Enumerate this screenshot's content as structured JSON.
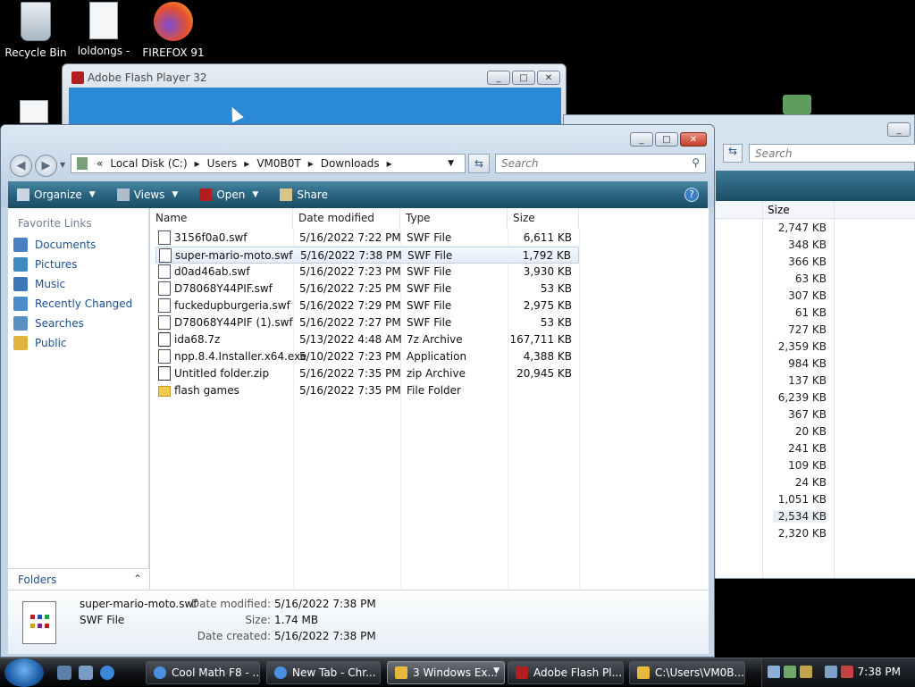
{
  "desktop": {
    "icons": [
      {
        "label": "Recycle Bin"
      },
      {
        "label": "loldongs -"
      },
      {
        "label": "FIREFOX 91"
      }
    ]
  },
  "flash_window": {
    "title": "Adobe Flash Player 32"
  },
  "bg_window": {
    "search_placeholder": "Search",
    "size_header": "Size",
    "sizes": [
      "2,747 KB",
      "348 KB",
      "366 KB",
      "63 KB",
      "307 KB",
      "61 KB",
      "727 KB",
      "2,359 KB",
      "984 KB",
      "137 KB",
      "6,239 KB",
      "367 KB",
      "20 KB",
      "241 KB",
      "109 KB",
      "24 KB",
      "1,051 KB",
      "2,534 KB",
      "2,320 KB"
    ]
  },
  "explorer": {
    "address": {
      "root": "«",
      "parts": [
        "Local Disk (C:)",
        "Users",
        "VM0B0T",
        "Downloads"
      ]
    },
    "search_placeholder": "Search",
    "toolbar": {
      "organize": "Organize",
      "views": "Views",
      "open": "Open",
      "share": "Share"
    },
    "nav": {
      "header": "Favorite Links",
      "items": [
        {
          "label": "Documents",
          "color": "#4a7fc1"
        },
        {
          "label": "Pictures",
          "color": "#3f8bc0"
        },
        {
          "label": "Music",
          "color": "#3b78b5"
        },
        {
          "label": "Recently Changed",
          "color": "#4d8bc9"
        },
        {
          "label": "Searches",
          "color": "#5a8fc4"
        },
        {
          "label": "Public",
          "color": "#e1b23c"
        }
      ],
      "folders": "Folders"
    },
    "columns": {
      "name": "Name",
      "date": "Date modified",
      "type": "Type",
      "size": "Size"
    },
    "files": [
      {
        "name": "3156f0a0.swf",
        "date": "5/16/2022 7:22 PM",
        "type": "SWF File",
        "size": "6,611 KB"
      },
      {
        "name": "super-mario-moto.swf",
        "date": "5/16/2022 7:38 PM",
        "type": "SWF File",
        "size": "1,792 KB"
      },
      {
        "name": "d0ad46ab.swf",
        "date": "5/16/2022 7:23 PM",
        "type": "SWF File",
        "size": "3,930 KB"
      },
      {
        "name": "D78068Y44PIF.swf",
        "date": "5/16/2022 7:25 PM",
        "type": "SWF File",
        "size": "53 KB"
      },
      {
        "name": "fuckedupburgeria.swf",
        "date": "5/16/2022 7:29 PM",
        "type": "SWF File",
        "size": "2,975 KB"
      },
      {
        "name": "D78068Y44PIF (1).swf",
        "date": "5/16/2022 7:27 PM",
        "type": "SWF File",
        "size": "53 KB"
      },
      {
        "name": "ida68.7z",
        "date": "5/13/2022 4:48 AM",
        "type": "7z Archive",
        "size": "167,711 KB"
      },
      {
        "name": "npp.8.4.Installer.x64.exe",
        "date": "5/10/2022 7:23 PM",
        "type": "Application",
        "size": "4,388 KB"
      },
      {
        "name": "Untitled folder.zip",
        "date": "5/16/2022 7:35 PM",
        "type": "zip Archive",
        "size": "20,945 KB"
      },
      {
        "name": "flash games",
        "date": "5/16/2022 7:35 PM",
        "type": "File Folder",
        "size": ""
      }
    ],
    "details": {
      "name": "super-mario-moto.swf",
      "type": "SWF File",
      "date_modified_label": "Date modified:",
      "date_modified": "5/16/2022 7:38 PM",
      "size_label": "Size:",
      "size": "1.74 MB",
      "date_created_label": "Date created:",
      "date_created": "5/16/2022 7:38 PM"
    }
  },
  "taskbar": {
    "tasks": [
      {
        "label": "Cool Math F8 - ..."
      },
      {
        "label": "New Tab - Chr..."
      },
      {
        "label": "3 Windows Ex..."
      },
      {
        "label": "Adobe Flash Pl..."
      },
      {
        "label": "C:\\Users\\VM0B..."
      }
    ],
    "clock": "7:38 PM"
  }
}
